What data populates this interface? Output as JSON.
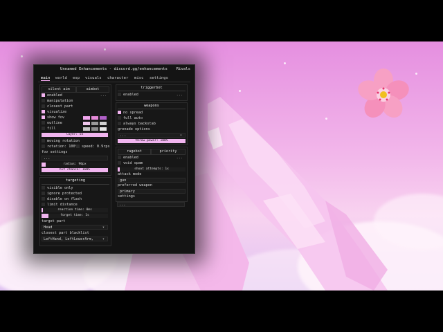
{
  "window": {
    "title": "Unnamed Enhancements - discord.gg/enhancements",
    "game": "Rivals"
  },
  "tabs": [
    "main",
    "world",
    "esp",
    "visuals",
    "character",
    "misc",
    "settings"
  ],
  "aim": {
    "modes": [
      "silent aim",
      "aimbot"
    ],
    "enabled": "enabled",
    "manipulation": "manipulation",
    "closest_part": "closest part",
    "visualize": "visualize",
    "show_fov": "show fov",
    "outline": "outline",
    "fill": "fill",
    "layer": "layer: 5x",
    "moving_rotation": "moving rotation",
    "rotation": "rotation: 100°",
    "speed": "speed: 0.9rps",
    "fov_settings": "fov settings",
    "radius": "radius: 90px",
    "hit_chance": "hit chance: 100%",
    "more_label": "..."
  },
  "targeting": {
    "header": "targeting",
    "visible_only": "visible only",
    "ignore_protected": "ignore protected",
    "disable_on_flash": "disable on flash",
    "limit_distance": "limit distance",
    "reaction_time": "reaction time: 0ms",
    "forget_time": "forget time: 1s",
    "target_part_label": "target part",
    "target_part_value": "Head",
    "blacklist_label": "closest part blacklist",
    "blacklist_value": "LeftHand, LeftLowerArm,"
  },
  "triggerbot": {
    "header": "triggerbot",
    "enabled": "enabled"
  },
  "weapons": {
    "header": "weapons",
    "no_spread": "no spread",
    "full_auto": "full auto",
    "always_backstab": "always backstab",
    "grenade_options": "grenade options",
    "slider": "throw power: 100%"
  },
  "ragebot": {
    "modes": [
      "ragebot",
      "priority"
    ],
    "enabled": "enabled",
    "void_spam": "void spam",
    "shoot_attempts": "shoot attempts: 1x",
    "attack_mode_label": "attack mode",
    "attack_mode_value": "gun",
    "preferred_weapon_label": "preferred weapon",
    "preferred_weapon_value": "primary",
    "settings_label": "settings",
    "settings_value": "..."
  },
  "colors": {
    "accent": "#f3b4f0",
    "panel": "#141414",
    "sky_top": "#e58fe0",
    "sky_bottom": "#e0c4f2"
  },
  "icons": {
    "flower": "cherry-blossom-icon"
  }
}
